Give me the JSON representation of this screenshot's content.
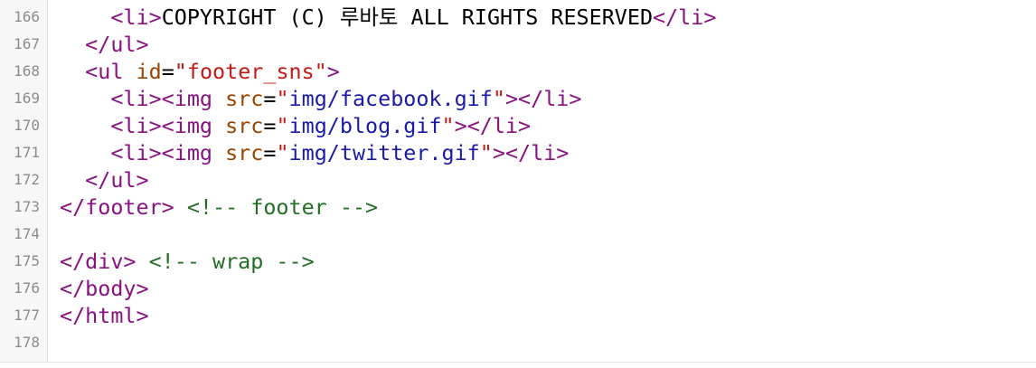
{
  "editor": {
    "colors": {
      "tag": "#881280",
      "attr": "#994500",
      "value": "#1a1aa6",
      "string_red": "#c41a16",
      "comment": "#236e25",
      "text": "#000000",
      "gutter_bg": "#f7f7f7",
      "line_number": "#8c8c8c"
    },
    "lines": [
      {
        "num": "166",
        "indent": "    ",
        "tokens": [
          {
            "t": "<li>",
            "k": "tag"
          },
          {
            "t": "COPYRIGHT (C) 루바토 ALL RIGHTS RESERVED",
            "k": "txt"
          },
          {
            "t": "</li>",
            "k": "tag"
          }
        ]
      },
      {
        "num": "167",
        "indent": "  ",
        "tokens": [
          {
            "t": "</ul>",
            "k": "tag"
          }
        ]
      },
      {
        "num": "168",
        "indent": "  ",
        "tokens": [
          {
            "t": "<ul ",
            "k": "tag"
          },
          {
            "t": "id",
            "k": "attr"
          },
          {
            "t": "=",
            "k": "txt"
          },
          {
            "t": "\"footer_sns\"",
            "k": "str"
          },
          {
            "t": ">",
            "k": "tag"
          }
        ]
      },
      {
        "num": "169",
        "indent": "    ",
        "tokens": [
          {
            "t": "<li><img ",
            "k": "tag"
          },
          {
            "t": "src",
            "k": "attr"
          },
          {
            "t": "=",
            "k": "txt"
          },
          {
            "t": "\"",
            "k": "str"
          },
          {
            "t": "img/facebook.gif",
            "k": "val"
          },
          {
            "t": "\"",
            "k": "str"
          },
          {
            "t": "></li>",
            "k": "tag"
          }
        ]
      },
      {
        "num": "170",
        "indent": "    ",
        "tokens": [
          {
            "t": "<li><img ",
            "k": "tag"
          },
          {
            "t": "src",
            "k": "attr"
          },
          {
            "t": "=",
            "k": "txt"
          },
          {
            "t": "\"",
            "k": "str"
          },
          {
            "t": "img/blog.gif",
            "k": "val"
          },
          {
            "t": "\"",
            "k": "str"
          },
          {
            "t": "></li>",
            "k": "tag"
          }
        ]
      },
      {
        "num": "171",
        "indent": "    ",
        "tokens": [
          {
            "t": "<li><img ",
            "k": "tag"
          },
          {
            "t": "src",
            "k": "attr"
          },
          {
            "t": "=",
            "k": "txt"
          },
          {
            "t": "\"",
            "k": "str"
          },
          {
            "t": "img/twitter.gif",
            "k": "val"
          },
          {
            "t": "\"",
            "k": "str"
          },
          {
            "t": "></li>",
            "k": "tag"
          }
        ]
      },
      {
        "num": "172",
        "indent": "  ",
        "tokens": [
          {
            "t": "</ul>",
            "k": "tag"
          }
        ]
      },
      {
        "num": "173",
        "indent": "",
        "tokens": [
          {
            "t": "</footer>",
            "k": "tag"
          },
          {
            "t": " ",
            "k": "txt"
          },
          {
            "t": "<!-- footer -->",
            "k": "cmt"
          }
        ]
      },
      {
        "num": "174",
        "indent": "",
        "tokens": []
      },
      {
        "num": "175",
        "indent": "",
        "tokens": [
          {
            "t": "</div>",
            "k": "tag"
          },
          {
            "t": " ",
            "k": "txt"
          },
          {
            "t": "<!-- wrap -->",
            "k": "cmt"
          }
        ]
      },
      {
        "num": "176",
        "indent": "",
        "tokens": [
          {
            "t": "</body>",
            "k": "tag"
          }
        ]
      },
      {
        "num": "177",
        "indent": "",
        "tokens": [
          {
            "t": "</html>",
            "k": "tag"
          }
        ]
      },
      {
        "num": "178",
        "indent": "",
        "tokens": []
      }
    ]
  }
}
